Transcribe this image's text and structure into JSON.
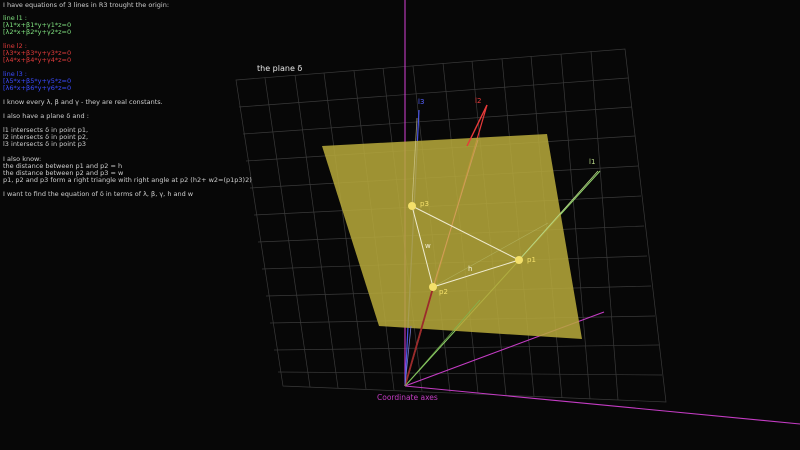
{
  "text": {
    "intro": "I have equations of 3 lines in R3 trought the origin:",
    "line1_title": "line l1 :",
    "line1_eq1": "[λ1*x+β1*y+γ1*z=0",
    "line1_eq2": "[λ2*x+β2*y+γ2*z=0",
    "line2_title": "line l2 :",
    "line2_eq1": "[λ3*x+β3*y+γ3*z=0",
    "line2_eq2": "[λ4*x+β4*y+γ4*z=0",
    "line3_title": "line l3 :",
    "line3_eq1": "[λ5*x+β5*y+γ5*z=0",
    "line3_eq2": "[λ6*x+β6*y+γ6*z=0",
    "constants": "I know every λ, β and γ - they are real constants.",
    "plane_intro": "I also have a plane δ and :",
    "intersect1": "l1 intersects δ in point p1,",
    "intersect2": "l2 intersects δ in point p2,",
    "intersect3": "l3 intersects δ in point p3",
    "also_know": "I also know:",
    "dist_h": "the distance between p1 and p2 = h",
    "dist_w": "the distance between p2 and p3 = w",
    "right_triangle": "p1, p2 and p3 form a right triangle with right angle at p2  (h2+ w2=(p1p3)2)",
    "goal": "I want to find the equation of δ in terms of λ, β, γ, h and w"
  },
  "diagram": {
    "plane_label": "the plane δ",
    "axes_label": "Coordinate axes",
    "l1": "l1",
    "l2": "l2",
    "l3": "l3",
    "p1": "p1",
    "p2": "p2",
    "p3": "p3",
    "h": "h",
    "w": "w"
  },
  "colors": {
    "background": "#070707",
    "plane_fill": "#b7a93a",
    "axes": "#c43cc4",
    "line_l1": "#8fd26a",
    "line_l2": "#e83a3a",
    "line_l3": "#4a55e8",
    "grid": "#3a3a3a",
    "text_gray": "#cfcfcf"
  }
}
